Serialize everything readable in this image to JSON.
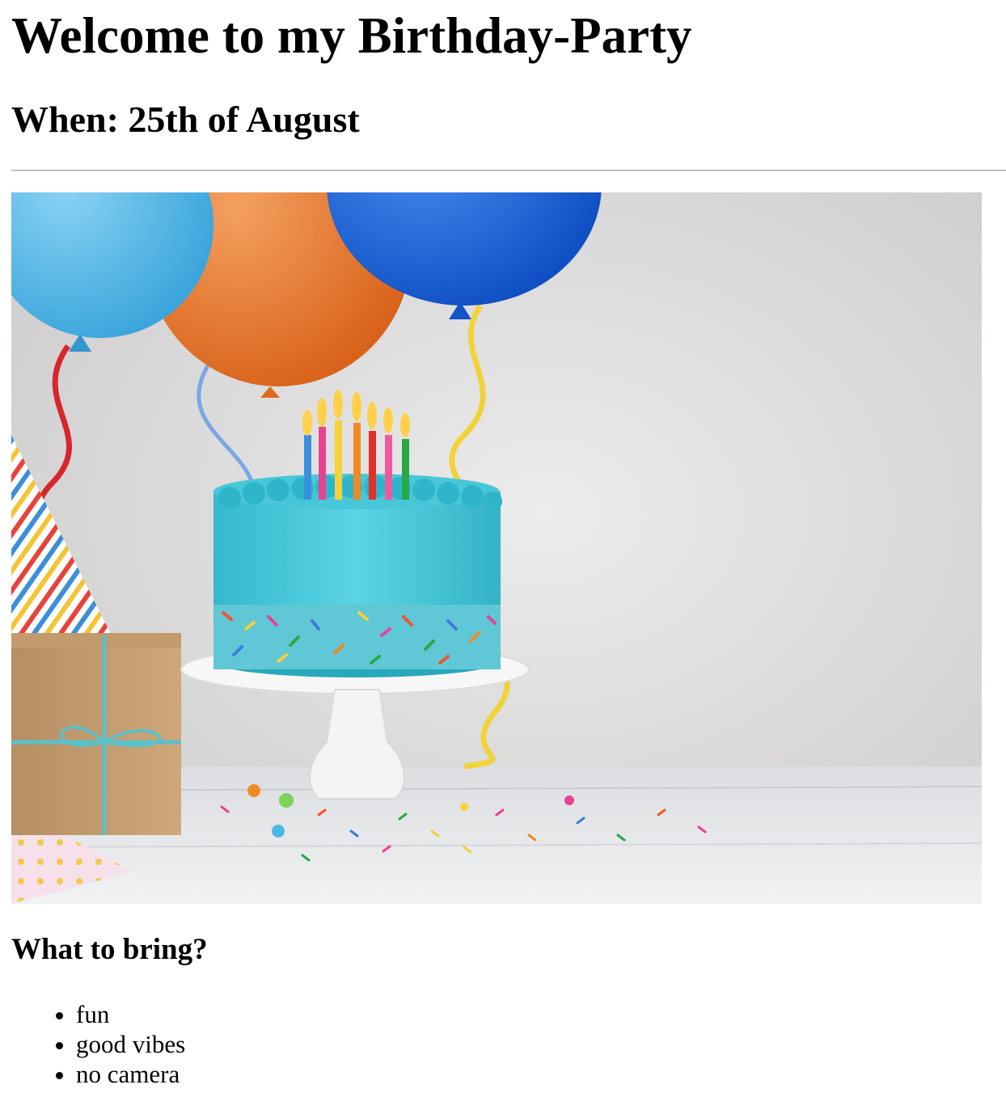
{
  "header": {
    "title": "Welcome to my Birthday-Party",
    "when": "When: 25th of August"
  },
  "image": {
    "subject": "birthday-cake-with-balloons",
    "colors": {
      "background": "#dddcdc",
      "cake": "#3fc6d8",
      "balloon_orange": "#e87a27",
      "balloon_blue": "#1a63d8",
      "balloon_lightblue": "#4cb6e6",
      "table": "#e9eaec"
    }
  },
  "bring": {
    "heading": "What to bring?",
    "items": [
      "fun",
      "good vibes",
      "no camera"
    ]
  }
}
